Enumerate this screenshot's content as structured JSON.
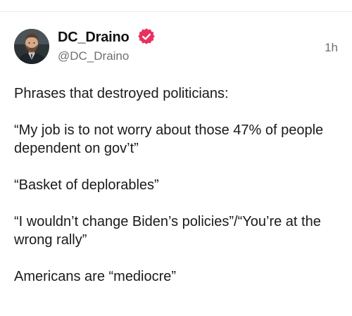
{
  "post": {
    "author": {
      "name": "DC_Draino",
      "handle": "@DC_Draino",
      "verified": true,
      "avatar_icon": "profile-photo"
    },
    "timestamp": "1h",
    "lines": [
      "Phrases that destroyed politicians:",
      "“My job is to not worry about those 47% of people dependent on gov’t”",
      "“Basket of deplorables”",
      "“I wouldn’t change Biden’s policies”/“You’re at the wrong rally”",
      "Americans are “mediocre”"
    ]
  },
  "colors": {
    "badge": "#e8315f",
    "muted_text": "#707070",
    "main_text": "#1a1a1a"
  }
}
